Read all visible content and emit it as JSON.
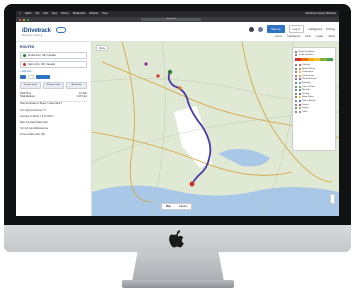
{
  "menubar": {
    "items": [
      "Safari",
      "File",
      "Edit",
      "View",
      "History",
      "Bookmarks",
      "Window",
      "Help"
    ],
    "right_text": "Rushmore Group, Brisbane"
  },
  "browser": {
    "url": "idrivetrack"
  },
  "header": {
    "logo": "iDrivetrack",
    "logo_sub": "Real-time tracking",
    "buttons": [
      "Sign up",
      "Log in"
    ],
    "links": [
      "Intelligence",
      "Pricing"
    ],
    "nav": [
      "Home",
      "Intelligence",
      "Fleet",
      "Leads",
      "About"
    ]
  },
  "sidebar": {
    "title": "ROUTES",
    "origin": "Fredericton, NB, Canada",
    "destination": "Saint John, NB, Canada",
    "add_stop": "+ Add stop",
    "modes": [
      "Fastest route",
      "Shortest route",
      "Avoid tolls"
    ],
    "summary": [
      {
        "label": "Total Time",
        "value": "1h 12m"
      },
      {
        "label": "Total Distance",
        "value": "107.6 km"
      }
    ],
    "steps": [
      "Head southeast on Route 7 toward Exit 2",
      "Turn right onto Route 7 S",
      "Continue on Route 7 S for 86 km",
      "Take exit toward Saint John",
      "Turn left onto Rothesay Ave",
      "Arrive at Saint John, NB"
    ]
  },
  "map": {
    "route_label": "Route",
    "type_buttons": [
      "Map",
      "Satellite"
    ]
  },
  "legend": {
    "title": "Road Conditions",
    "subtitle": "Traffic Incidents",
    "items": [
      {
        "label": "Collision",
        "color": "#d93025"
      },
      {
        "label": "Road Closure",
        "color": "#e8710a"
      },
      {
        "label": "Congestion",
        "color": "#f9ab00"
      },
      {
        "label": "Construction",
        "color": "#f57c00"
      },
      {
        "label": "Planned Event",
        "color": "#8e24aa"
      },
      {
        "label": "Flooding",
        "color": "#1e88e5"
      },
      {
        "label": "Lane Closure",
        "color": "#43a047"
      },
      {
        "label": "Weather",
        "color": "#00897b"
      },
      {
        "label": "Hazard",
        "color": "#6d4c41"
      },
      {
        "label": "Road Works",
        "color": "#fbc02d"
      },
      {
        "label": "Police Activity",
        "color": "#3949ab"
      },
      {
        "label": "Detour",
        "color": "#c2185b"
      },
      {
        "label": "Delays",
        "color": "#7cb342"
      },
      {
        "label": "Other",
        "color": "#757575"
      }
    ],
    "bar_colors": [
      "#d93025",
      "#e8710a",
      "#f9ab00",
      "#fbc02d",
      "#7cb342",
      "#43a047"
    ]
  },
  "colors": {
    "accent": "#2d72c4",
    "route": "#4a3aa8",
    "land": "#dfe9d3",
    "water": "#a9c7e6"
  }
}
